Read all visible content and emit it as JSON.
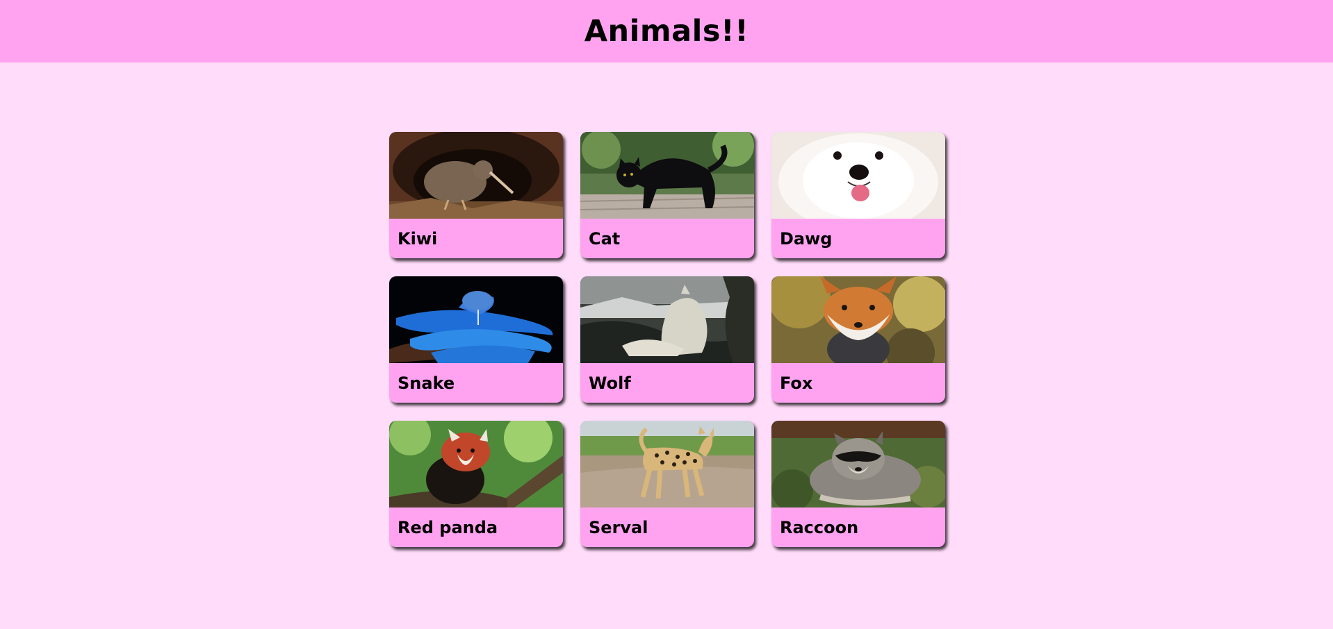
{
  "header": {
    "title": "Animals!!"
  },
  "colors": {
    "page_background": "#ffdcfa",
    "header_background": "#ffa3f0",
    "card_label_background": "#ffa3f0"
  },
  "cards": [
    {
      "label": "Kiwi",
      "icon": "kiwi-photo"
    },
    {
      "label": "Cat",
      "icon": "cat-photo"
    },
    {
      "label": "Dawg",
      "icon": "dog-photo"
    },
    {
      "label": "Snake",
      "icon": "snake-photo"
    },
    {
      "label": "Wolf",
      "icon": "wolf-photo"
    },
    {
      "label": "Fox",
      "icon": "fox-photo"
    },
    {
      "label": "Red panda",
      "icon": "red-panda-photo"
    },
    {
      "label": "Serval",
      "icon": "serval-photo"
    },
    {
      "label": "Raccoon",
      "icon": "raccoon-photo"
    }
  ]
}
